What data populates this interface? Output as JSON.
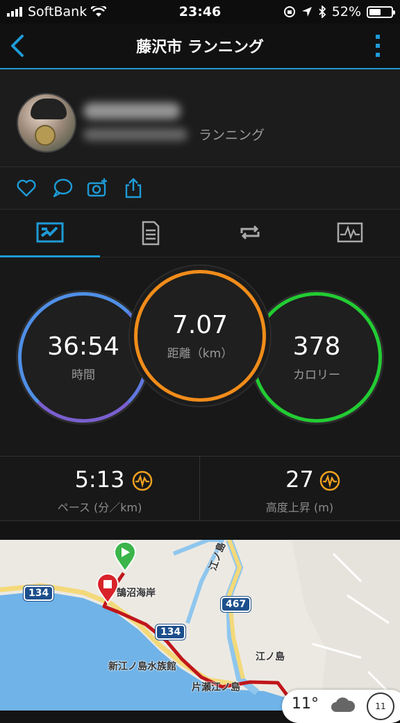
{
  "status_bar": {
    "carrier": "SoftBank",
    "time": "23:46",
    "battery": "52%",
    "battery_level": 0.52
  },
  "navbar": {
    "title": "藤沢市 ランニング"
  },
  "profile": {
    "activity_type": "ランニング"
  },
  "tabs": [
    "overview",
    "details",
    "laps",
    "charts"
  ],
  "stats": {
    "time": {
      "value": "36:54",
      "label": "時間"
    },
    "distance": {
      "value": "7.07",
      "label": "距離（km）"
    },
    "calories": {
      "value": "378",
      "label": "カロリー"
    }
  },
  "metrics": {
    "pace": {
      "value": "5:13",
      "label": "ペース (分／km)"
    },
    "elevation": {
      "value": "27",
      "label": "高度上昇 (m)"
    }
  },
  "map": {
    "route_numbers": {
      "r134_a": "134",
      "r134_b": "134",
      "r467": "467"
    },
    "place_labels": {
      "kugenuma": "鵠沼海岸",
      "aquarium": "新江ノ島水族館",
      "katase": "片瀬江ノ島",
      "enoshima_st": "江ノ島",
      "enoden": "江ノ島"
    },
    "weather": {
      "temp": "11°",
      "day": "11"
    }
  },
  "colors": {
    "accent": "#1e9bd7",
    "time_ring": "#4f8fe6",
    "distance_ring": "#f08c1a",
    "calorie_ring": "#22cc33",
    "metric_icon": "#f0a020",
    "route": "#c0161b"
  }
}
